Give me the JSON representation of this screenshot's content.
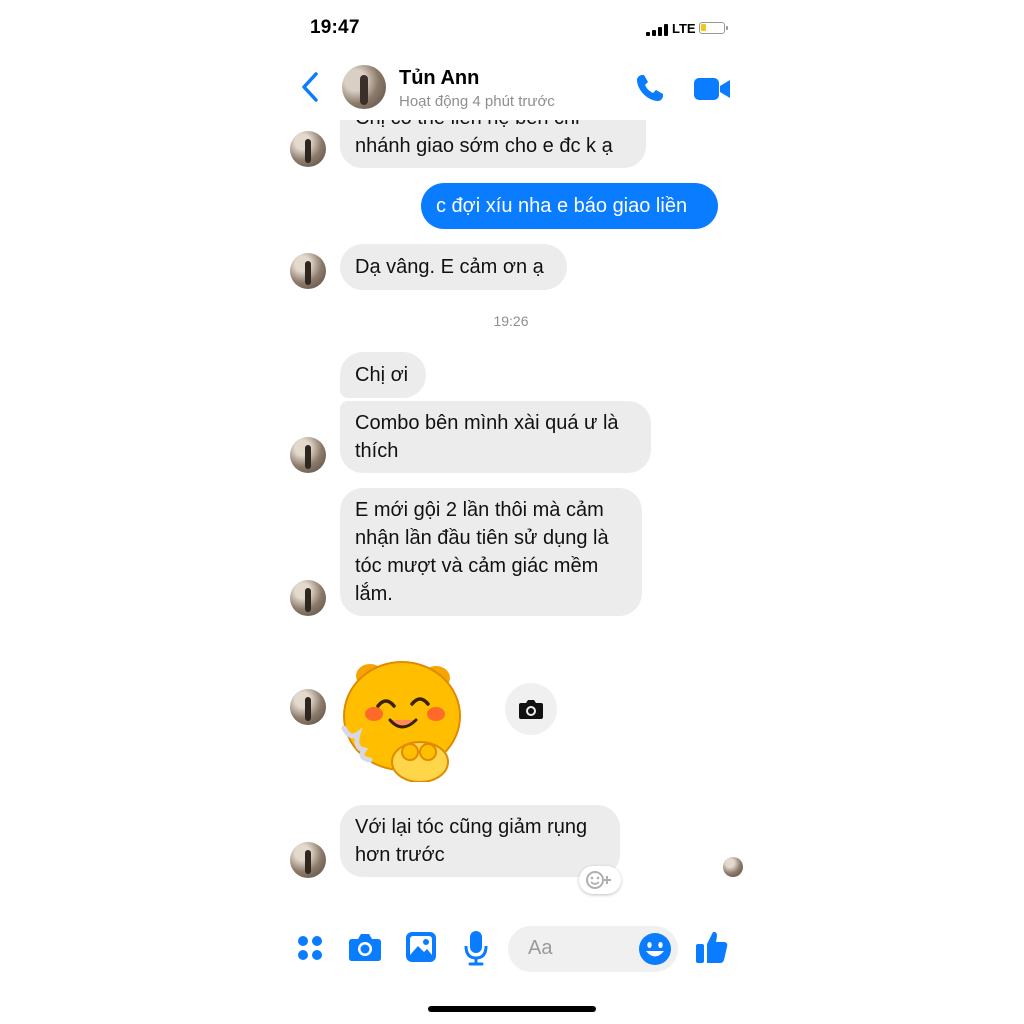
{
  "status_bar": {
    "time": "19:47",
    "network": "LTE",
    "battery_level": 0.25
  },
  "header": {
    "contact_name": "Tủn Ann",
    "active_status": "Hoạt động 4 phút trước",
    "icons": [
      "back-chevron-icon",
      "phone-icon",
      "video-camera-icon"
    ]
  },
  "conversation": {
    "messages": [
      {
        "sender": "contact",
        "text_line1": "Chị có thể liên hệ bên chi",
        "text_line2": "nhánh giao sớm cho e đc k ạ"
      },
      {
        "sender": "me",
        "text": "c đợi xíu nha e báo giao liền"
      },
      {
        "sender": "contact",
        "text": "Dạ vâng. E cảm ơn ạ"
      },
      {
        "sender": "contact",
        "text": "Chị ơi"
      },
      {
        "sender": "contact",
        "text_line1": "Combo bên mình xài quá ư là",
        "text_line2": "thích"
      },
      {
        "sender": "contact",
        "text_line1": "E mới gội 2 lần thôi mà cảm",
        "text_line2": "nhận lần đầu tiên sử dụng là",
        "text_line3": "tóc mượt và cảm giác mềm",
        "text_line4": "lắm."
      },
      {
        "sender": "contact",
        "sticker": "happy-yellow-bear-sticker"
      },
      {
        "sender": "contact",
        "text_line1": "Với lại tóc cũng giảm rụng",
        "text_line2": "hơn trước"
      }
    ],
    "timestamp": "19:26"
  },
  "composer": {
    "placeholder": "Aa",
    "icons": [
      "more-apps-icon",
      "camera-icon",
      "gallery-icon",
      "microphone-icon",
      "emoji-icon",
      "thumbs-up-icon"
    ]
  },
  "colors": {
    "accent": "#0a7cff",
    "incoming_bubble": "#ececec",
    "muted_text": "#8e8e93"
  }
}
